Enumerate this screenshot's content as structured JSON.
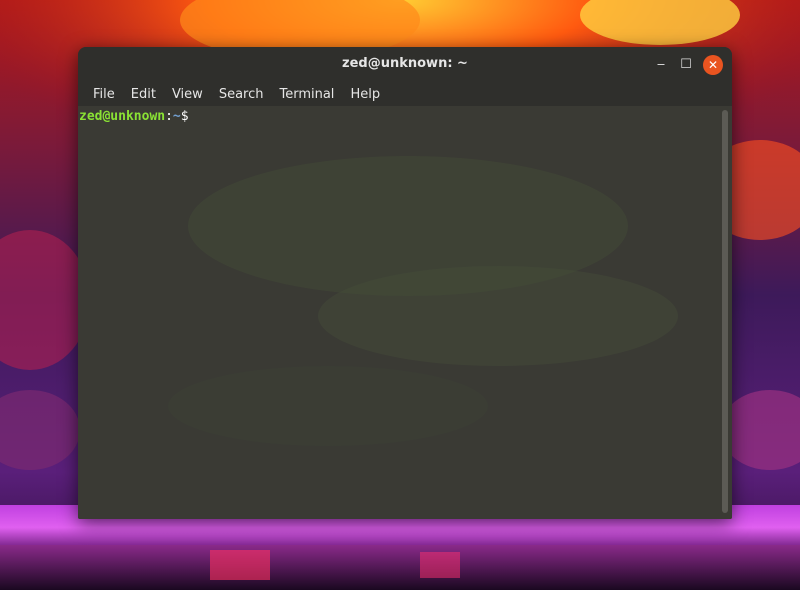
{
  "window": {
    "title": "zed@unknown: ~",
    "controls": {
      "minimize": "‒",
      "maximize": "☐",
      "close": "✕"
    }
  },
  "menubar": {
    "items": [
      "File",
      "Edit",
      "View",
      "Search",
      "Terminal",
      "Help"
    ]
  },
  "terminal": {
    "prompt_user": "zed@unknown",
    "prompt_sep": ":",
    "prompt_path": "~",
    "prompt_symbol": "$"
  },
  "colors": {
    "prompt_user": "#8ae234",
    "prompt_path": "#729fcf",
    "close_button": "#e95420"
  }
}
